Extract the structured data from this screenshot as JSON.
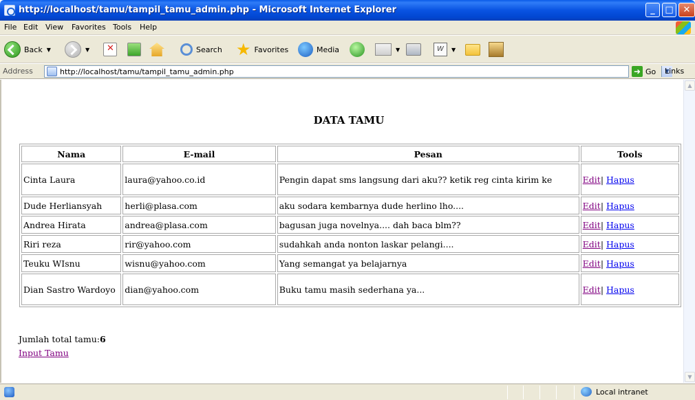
{
  "window": {
    "title": "http://localhost/tamu/tampil_tamu_admin.php - Microsoft Internet Explorer"
  },
  "menu": {
    "items": [
      "File",
      "Edit",
      "View",
      "Favorites",
      "Tools",
      "Help"
    ]
  },
  "toolbar": {
    "back": "Back",
    "search": "Search",
    "favorites": "Favorites",
    "media": "Media"
  },
  "address": {
    "label": "Address",
    "url": "http://localhost/tamu/tampil_tamu_admin.php",
    "go": "Go",
    "links": "Links"
  },
  "page": {
    "heading": "DATA TAMU",
    "columns": [
      "Nama",
      "E-mail",
      "Pesan",
      "Tools"
    ],
    "rows": [
      {
        "nama": "Cinta Laura",
        "email": "laura@yahoo.co.id",
        "pesan": "Pengin dapat sms langsung dari aku?? ketik reg cinta kirim ke",
        "edit": "Edit",
        "sep": "|",
        "hapus": "Hapus"
      },
      {
        "nama": "Dude Herliansyah",
        "email": "herli@plasa.com",
        "pesan": "aku sodara kembarnya dude herlino lho....",
        "edit": "Edit",
        "sep": "|",
        "hapus": "Hapus"
      },
      {
        "nama": "Andrea Hirata",
        "email": "andrea@plasa.com",
        "pesan": "bagusan juga novelnya.... dah baca blm??",
        "edit": "Edit",
        "sep": "|",
        "hapus": "Hapus"
      },
      {
        "nama": "Riri reza",
        "email": "rir@yahoo.com",
        "pesan": "sudahkah anda nonton laskar pelangi....",
        "edit": "Edit",
        "sep": "|",
        "hapus": "Hapus"
      },
      {
        "nama": "Teuku WIsnu",
        "email": "wisnu@yahoo.com",
        "pesan": "Yang semangat ya belajarnya",
        "edit": "Edit",
        "sep": "|",
        "hapus": "Hapus"
      },
      {
        "nama": "Dian Sastro Wardoyo",
        "email": "dian@yahoo.com",
        "pesan": "Buku tamu masih sederhana ya...",
        "edit": "Edit",
        "sep": "|",
        "hapus": "Hapus"
      }
    ],
    "total_label": "Jumlah total tamu:",
    "total_value": "6",
    "input_link": "Input Tamu"
  },
  "status": {
    "zone": "Local intranet"
  },
  "colors": {
    "titlebar": "#0953e2",
    "chrome": "#ece9d8",
    "link": "#0000ee",
    "visited": "#800080"
  }
}
